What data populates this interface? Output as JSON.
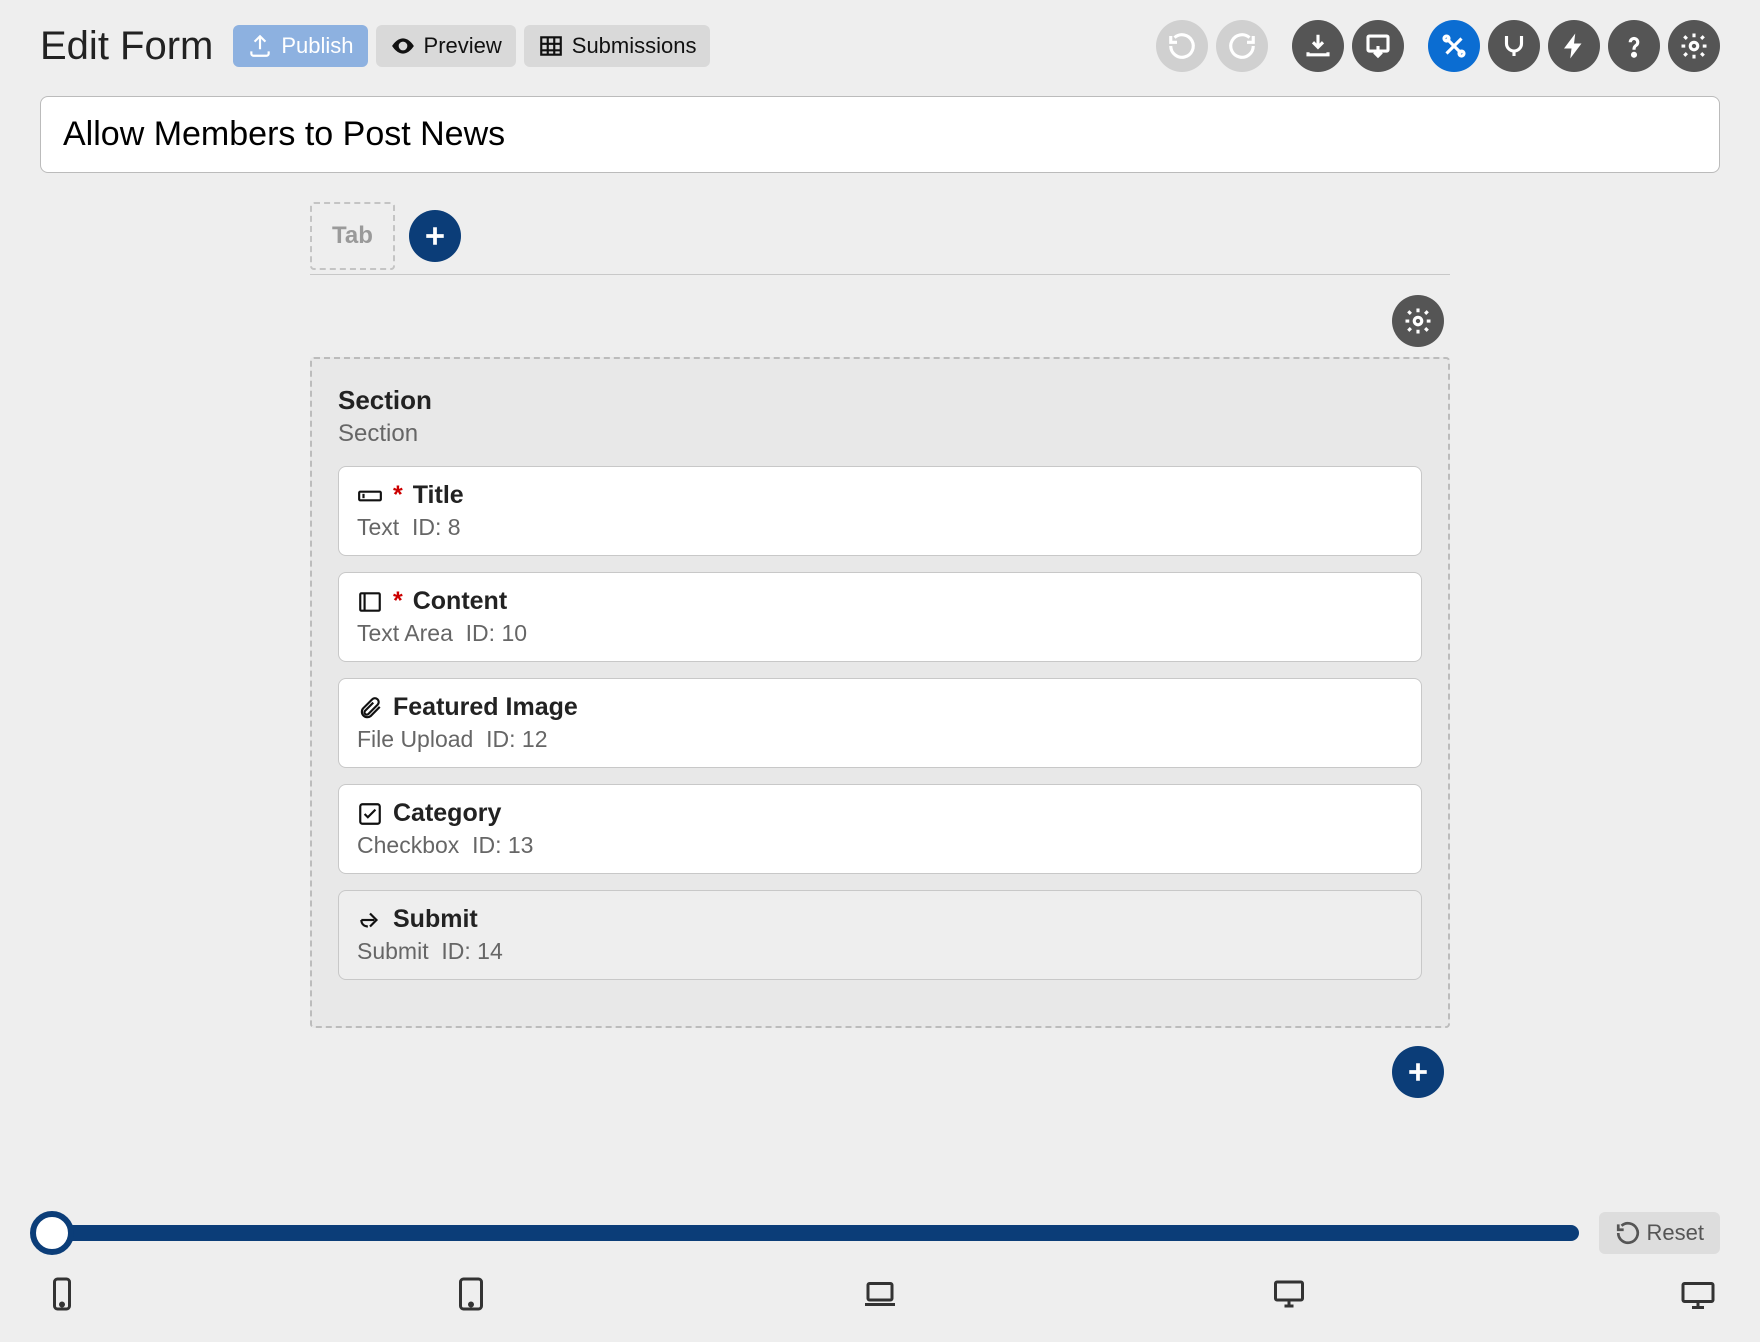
{
  "header": {
    "title": "Edit Form",
    "publish_label": "Publish",
    "preview_label": "Preview",
    "submissions_label": "Submissions"
  },
  "form": {
    "title_value": "Allow Members to Post News"
  },
  "tabs": {
    "placeholder": "Tab"
  },
  "section": {
    "title": "Section",
    "subtitle": "Section",
    "fields": [
      {
        "label": "Title",
        "type_label": "Text",
        "id_label": "ID: 8",
        "required": true,
        "icon": "text-input-icon"
      },
      {
        "label": "Content",
        "type_label": "Text Area",
        "id_label": "ID: 10",
        "required": true,
        "icon": "textarea-icon"
      },
      {
        "label": "Featured Image",
        "type_label": "File Upload",
        "id_label": "ID: 12",
        "required": false,
        "icon": "paperclip-icon"
      },
      {
        "label": "Category",
        "type_label": "Checkbox",
        "id_label": "ID: 13",
        "required": false,
        "icon": "checkbox-icon"
      },
      {
        "label": "Submit",
        "type_label": "Submit",
        "id_label": "ID: 14",
        "required": false,
        "icon": "submit-icon",
        "is_submit": true
      }
    ]
  },
  "footer": {
    "reset_label": "Reset"
  }
}
